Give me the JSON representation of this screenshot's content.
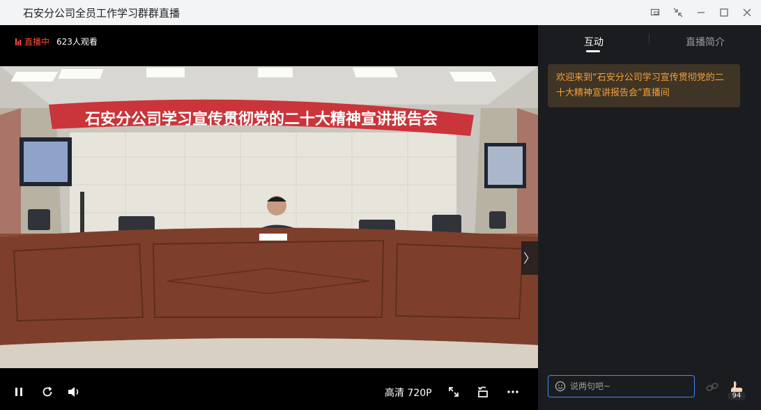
{
  "window": {
    "title": "石安分公司全员工作学习群群直播"
  },
  "player": {
    "live_label": "直播中",
    "viewers": "623人观看",
    "banner_text": "石安分公司学习宣传贯彻党的二十大精神宣讲报告会",
    "quality": "高清 720P",
    "next_arrow": "〉"
  },
  "sidebar": {
    "tabs": [
      {
        "label": "互动",
        "active": true
      },
      {
        "label": "直播简介",
        "active": false
      }
    ],
    "welcome_message": "欢迎来到“石安分公司学习宣传贯彻党的二十大精神宣讲报告会”直播间",
    "chat_placeholder": "说两句吧~",
    "like_count": "94"
  },
  "colors": {
    "live_red": "#ff4b3a",
    "welcome_text": "#f5a13a",
    "welcome_bg": "#3f3526",
    "input_border": "#3b8cff",
    "sidebar_bg": "#1b1c1f",
    "banner_red": "#c9353a"
  },
  "icons": {
    "titlebar": [
      "pin-window-icon",
      "shrink-icon",
      "minimize-icon",
      "maximize-icon",
      "close-icon"
    ],
    "controls": [
      "pause-icon",
      "refresh-icon",
      "volume-icon",
      "fullscreen-icon",
      "rotate-icon",
      "more-icon"
    ],
    "chat": [
      "smile-icon",
      "link-icon",
      "like-hand-icon"
    ]
  }
}
